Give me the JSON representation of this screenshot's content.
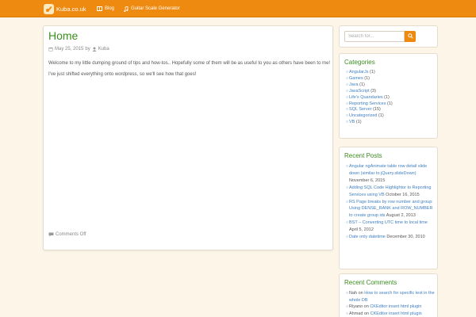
{
  "nav": {
    "brand": "Kuba.co.uk",
    "items": [
      {
        "label": "Blog",
        "icon": "book-icon"
      },
      {
        "label": "Guitar Scale Generator",
        "icon": "music-note-icon"
      }
    ],
    "color": "#ef8a10"
  },
  "post": {
    "title": "Home",
    "date": "May 25, 2015",
    "by": "by",
    "author": "Kuba",
    "paragraphs": [
      "Welcome to my little dumping ground of tips and how-tos.. Hopefully some of them will be as useful to you as others have been to me!",
      "I've just shifted everything onto wordpress, so we'll see how that goes!"
    ],
    "comments": "Comments Off"
  },
  "search": {
    "placeholder": "Search for..."
  },
  "categories": {
    "title": "Categories",
    "items": [
      {
        "name": "AngularJs",
        "count": "(1)"
      },
      {
        "name": "Games",
        "count": "(1)"
      },
      {
        "name": "Java",
        "count": "(1)"
      },
      {
        "name": "JavaScript",
        "count": "(3)"
      },
      {
        "name": "Life's Quandaries",
        "count": "(1)"
      },
      {
        "name": "Reporting Services",
        "count": "(1)"
      },
      {
        "name": "SQL Server",
        "count": "(15)"
      },
      {
        "name": "Uncategorized",
        "count": "(1)"
      },
      {
        "name": "VB",
        "count": "(1)"
      }
    ]
  },
  "recent_posts": {
    "title": "Recent Posts",
    "items": [
      {
        "link": "Angular ngAnimate table row detail slide down (similar to jQuery.slideDown)",
        "date": "November 6, 2015"
      },
      {
        "link": "Adding SQL Code Highlightor to Reporting Services using VB",
        "date": "October 16, 2015"
      },
      {
        "link": "RS Page breaks by row number and group: Using DENSE_RANK and ROW_NUMBER to create group ids",
        "date": "August 2, 2013"
      },
      {
        "link": "BST – Converting UTC time to local time",
        "date": "April 5, 2012"
      },
      {
        "link": "Date only datetime",
        "date": "December 30, 2010"
      }
    ]
  },
  "recent_comments": {
    "title": "Recent Comments",
    "items": [
      {
        "author": "Nah",
        "on": "on",
        "post": "How to search for specific text in the whole DB"
      },
      {
        "author": "Riyano",
        "on": "on",
        "post": "CKEditor insert html plugin"
      },
      {
        "author": "Ahmad",
        "on": "on",
        "post": "CKEditor insert html plugin"
      }
    ]
  }
}
